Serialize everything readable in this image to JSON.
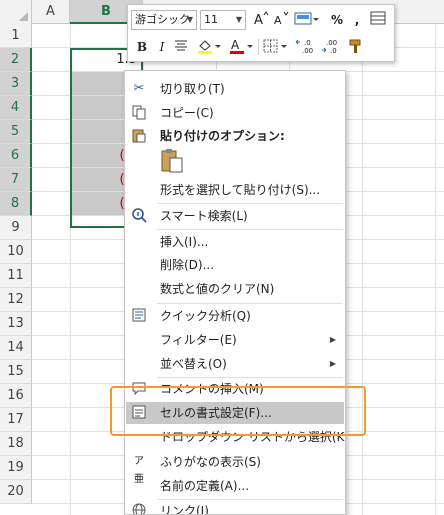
{
  "sheet": {
    "columns": [
      "A",
      "B"
    ],
    "rows": [
      "1",
      "2",
      "3",
      "4",
      "5",
      "6",
      "7",
      "8",
      "9",
      "10",
      "11",
      "12",
      "13",
      "14",
      "15",
      "16",
      "17",
      "18",
      "19",
      "20"
    ],
    "cells": [
      {
        "text": "1.5",
        "filled": false,
        "negative": false
      },
      {
        "text": "1.",
        "filled": true,
        "negative": false
      },
      {
        "text": "0.",
        "filled": true,
        "negative": false
      },
      {
        "text": "0.",
        "filled": true,
        "negative": false
      },
      {
        "text": "(0.",
        "filled": true,
        "negative": true
      },
      {
        "text": "(1.",
        "filled": true,
        "negative": true
      },
      {
        "text": "(1.",
        "filled": true,
        "negative": true
      }
    ]
  },
  "mini_toolbar": {
    "font_name": "游ゴシック",
    "font_size": "11",
    "bold": "B",
    "italic": "I",
    "percent": "%",
    "comma": ",",
    "increase_decimal": "←.0 .00",
    "decrease_decimal": ".00 →.0"
  },
  "menu": {
    "cut": "切り取り(T)",
    "copy": "コピー(C)",
    "paste_options": "貼り付けのオプション:",
    "paste_special": "形式を選択して貼り付け(S)...",
    "smart_lookup": "スマート検索(L)",
    "insert": "挿入(I)...",
    "delete": "削除(D)...",
    "clear_contents": "数式と値のクリア(N)",
    "quick_analysis": "クイック分析(Q)",
    "filter": "フィルター(E)",
    "sort": "並べ替え(O)",
    "insert_comment": "コメントの挿入(M)",
    "format_cells": "セルの書式設定(F)...",
    "pick_from_list": "ドロップダウン リストから選択(K)...",
    "show_phonetic": "ふりがなの表示(S)",
    "define_name": "名前の定義(A)...",
    "link": "リンク(I)"
  },
  "colors": {
    "highlight_annotation": "#f59a23",
    "selection": "#217346",
    "negative_text": "#c00000",
    "menu_hover": "#c8c8c8"
  }
}
